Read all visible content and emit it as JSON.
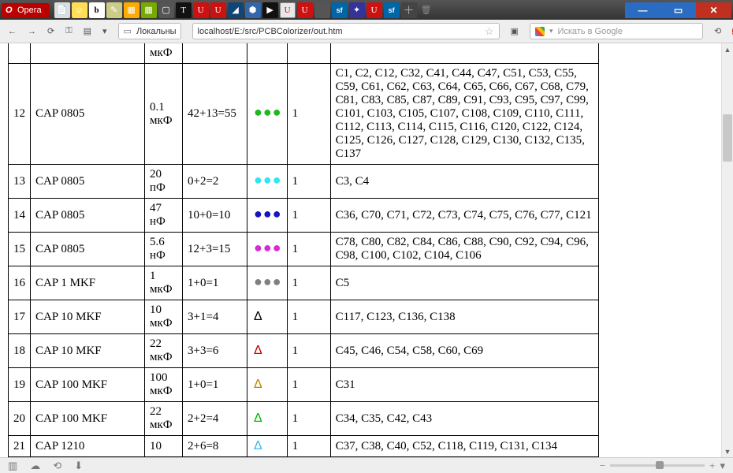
{
  "window": {
    "menu": "Opera"
  },
  "toolbar": {
    "local_label": "Локальный",
    "url": "localhost/E:/src/PCBColorizer/out.htm",
    "search_placeholder": "Искать в Google"
  },
  "table": {
    "row0": {
      "val": "мкФ"
    },
    "rows": [
      {
        "n": "12",
        "name": "CAP 0805",
        "val": "0.1 мкФ",
        "calc": "42+13=55",
        "sym": "●●●",
        "sym_color": "#1db81d",
        "one": "1",
        "refs": "C1, C2, C12, C32, C41, C44, C47, C51, C53, C55, C59, C61, C62, C63, C64, C65, C66, C67, C68, C79, C81, C83, C85, C87, C89, C91, C93, C95, C97, C99, C101, C103, C105, C107, C108, C109, C110, C111, C112, C113, C114, C115, C116, C120, C122, C124, C125, C126, C127, C128, C129, C130, C132, C135, C137"
      },
      {
        "n": "13",
        "name": "CAP 0805",
        "val": "20 пФ",
        "calc": "0+2=2",
        "sym": "●●●",
        "sym_color": "#33e6ee",
        "one": "1",
        "refs": "C3, C4"
      },
      {
        "n": "14",
        "name": "CAP 0805",
        "val": "47 нФ",
        "calc": "10+0=10",
        "sym": "●●●",
        "sym_color": "#1414c0",
        "one": "1",
        "refs": "C36, C70, C71, C72, C73, C74, C75, C76, C77, C121"
      },
      {
        "n": "15",
        "name": "CAP 0805",
        "val": "5.6 нФ",
        "calc": "12+3=15",
        "sym": "●●●",
        "sym_color": "#d828d8",
        "one": "1",
        "refs": "C78, C80, C82, C84, C86, C88, C90, C92, C94, C96, C98, C100, C102, C104, C106"
      },
      {
        "n": "16",
        "name": "CAP 1 MKF",
        "val": "1 мкФ",
        "calc": "1+0=1",
        "sym": "●●●",
        "sym_color": "#808080",
        "one": "1",
        "refs": "C5"
      },
      {
        "n": "17",
        "name": "CAP 10 MKF",
        "val": "10 мкФ",
        "calc": "3+1=4",
        "sym": "Δ",
        "sym_color": "#000000",
        "one": "1",
        "refs": "C117, C123, C136, C138"
      },
      {
        "n": "18",
        "name": "CAP 10 MKF",
        "val": "22 мкФ",
        "calc": "3+3=6",
        "sym": "Δ",
        "sym_color": "#cc0000",
        "one": "1",
        "refs": "C45, C46, C54, C58, C60, C69"
      },
      {
        "n": "19",
        "name": "CAP 100 MKF",
        "val": "100 мкФ",
        "calc": "1+0=1",
        "sym": "Δ",
        "sym_color": "#bb8800",
        "one": "1",
        "refs": "C31"
      },
      {
        "n": "20",
        "name": "CAP 100 MKF",
        "val": "22 мкФ",
        "calc": "2+2=4",
        "sym": "Δ",
        "sym_color": "#00bb00",
        "one": "1",
        "refs": "C34, C35, C42, C43"
      },
      {
        "n": "21",
        "name": "CAP 1210",
        "val": "10",
        "calc": "2+6=8",
        "sym": "Δ",
        "sym_color": "#33bbee",
        "one": "1",
        "refs": "C37, C38, C40, C52, C118, C119, C131, C134"
      }
    ]
  }
}
